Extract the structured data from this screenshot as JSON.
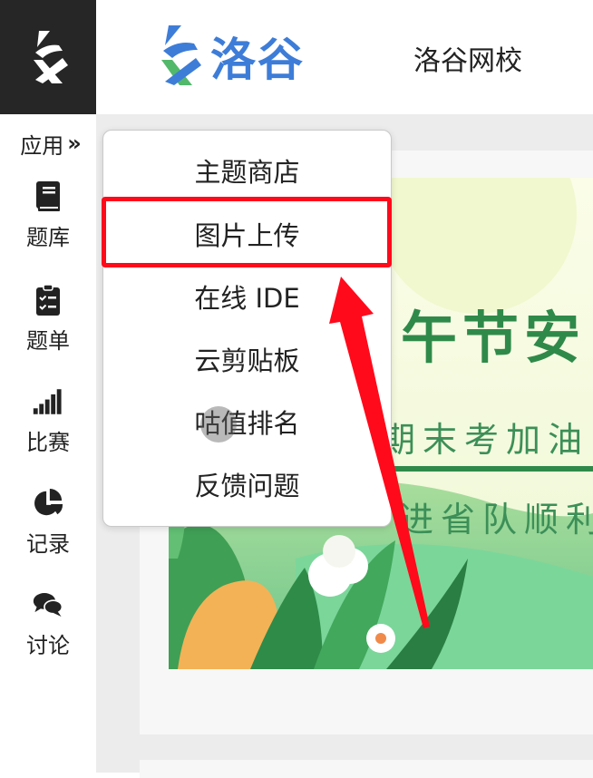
{
  "brand": {
    "name": "洛谷",
    "school_link": "洛谷网校"
  },
  "sidebar": {
    "apps_toggle": {
      "label": "应用",
      "chevron": "»",
      "icon": "double-chevron-right-icon"
    },
    "items": [
      {
        "label": "题库",
        "icon": "book-icon"
      },
      {
        "label": "题单",
        "icon": "clipboard-list-icon"
      },
      {
        "label": "比赛",
        "icon": "signal-bars-icon"
      },
      {
        "label": "记录",
        "icon": "pie-chart-icon"
      },
      {
        "label": "讨论",
        "icon": "chat-bubbles-icon"
      }
    ]
  },
  "apps_menu": {
    "items": [
      {
        "label": "主题商店"
      },
      {
        "label": "图片上传",
        "highlighted": true
      },
      {
        "label": "在线 IDE"
      },
      {
        "label": "云剪贴板"
      },
      {
        "label": "咕值排名"
      },
      {
        "label": "反馈问题"
      }
    ]
  },
  "banner": {
    "title": "午节安",
    "subtitle1": "期末考加油",
    "subtitle2": "进省队顺利"
  },
  "colors": {
    "sidebar_logo_bg": "#262626",
    "brand_blue": "#3d7dd8",
    "brand_green": "#52b96a",
    "annotation_red": "#ff0a1b",
    "banner_green": "#2f8a4a"
  }
}
